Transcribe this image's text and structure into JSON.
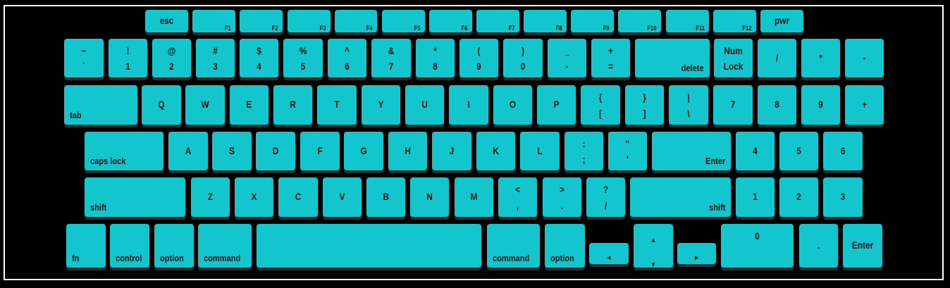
{
  "keyboard": {
    "key_color": "#13c5cd",
    "keys": [
      {
        "id": "esc",
        "label": "esc"
      },
      {
        "id": "f1",
        "label": "F1"
      },
      {
        "id": "f2",
        "label": "F2"
      },
      {
        "id": "f3",
        "label": "F3"
      },
      {
        "id": "f4",
        "label": "F4"
      },
      {
        "id": "f5",
        "label": "F5"
      },
      {
        "id": "f6",
        "label": "F6"
      },
      {
        "id": "f7",
        "label": "F7"
      },
      {
        "id": "f8",
        "label": "F8"
      },
      {
        "id": "f9",
        "label": "F9"
      },
      {
        "id": "f10",
        "label": "F10"
      },
      {
        "id": "f11",
        "label": "F11"
      },
      {
        "id": "f12",
        "label": "F12"
      },
      {
        "id": "pwr",
        "label": "pwr"
      },
      {
        "id": "backtick",
        "top": "~",
        "bottom": "`"
      },
      {
        "id": "1",
        "top": "!",
        "bottom": "1"
      },
      {
        "id": "2",
        "top": "@",
        "bottom": "2"
      },
      {
        "id": "3",
        "top": "#",
        "bottom": "3"
      },
      {
        "id": "4",
        "top": "$",
        "bottom": "4"
      },
      {
        "id": "5",
        "top": "%",
        "bottom": "5"
      },
      {
        "id": "6",
        "top": "^",
        "bottom": "6"
      },
      {
        "id": "7",
        "top": "&",
        "bottom": "7"
      },
      {
        "id": "8",
        "top": "*",
        "bottom": "8"
      },
      {
        "id": "9",
        "top": "(",
        "bottom": "9"
      },
      {
        "id": "0",
        "top": ")",
        "bottom": "0"
      },
      {
        "id": "minus",
        "top": "_",
        "bottom": "-"
      },
      {
        "id": "equals",
        "top": "+",
        "bottom": "="
      },
      {
        "id": "delete",
        "label": "delete"
      },
      {
        "id": "numlock",
        "top": "Num",
        "bottom": "Lock"
      },
      {
        "id": "num-slash",
        "label": "/"
      },
      {
        "id": "num-star",
        "label": "*"
      },
      {
        "id": "num-minus",
        "label": "-"
      },
      {
        "id": "tab",
        "label": "tab"
      },
      {
        "id": "q",
        "label": "Q"
      },
      {
        "id": "w",
        "label": "W"
      },
      {
        "id": "e",
        "label": "E"
      },
      {
        "id": "r",
        "label": "R"
      },
      {
        "id": "t",
        "label": "T"
      },
      {
        "id": "y",
        "label": "Y"
      },
      {
        "id": "u",
        "label": "U"
      },
      {
        "id": "i",
        "label": "I"
      },
      {
        "id": "o",
        "label": "O"
      },
      {
        "id": "p",
        "label": "P"
      },
      {
        "id": "lbracket",
        "top": "{",
        "bottom": "["
      },
      {
        "id": "rbracket",
        "top": "}",
        "bottom": "]"
      },
      {
        "id": "backslash",
        "top": "|",
        "bottom": "\\"
      },
      {
        "id": "num7",
        "label": "7"
      },
      {
        "id": "num8",
        "label": "8"
      },
      {
        "id": "num9",
        "label": "9"
      },
      {
        "id": "num-plus",
        "label": "+"
      },
      {
        "id": "capslock",
        "label": "caps lock"
      },
      {
        "id": "a",
        "label": "A"
      },
      {
        "id": "s",
        "label": "S"
      },
      {
        "id": "d",
        "label": "D"
      },
      {
        "id": "f",
        "label": "F"
      },
      {
        "id": "g",
        "label": "G"
      },
      {
        "id": "h",
        "label": "H"
      },
      {
        "id": "j",
        "label": "J"
      },
      {
        "id": "k",
        "label": "K"
      },
      {
        "id": "l",
        "label": "L"
      },
      {
        "id": "semicolon",
        "top": ":",
        "bottom": ";"
      },
      {
        "id": "quote",
        "top": "\"",
        "bottom": "'"
      },
      {
        "id": "enter",
        "label": "Enter"
      },
      {
        "id": "num4",
        "label": "4"
      },
      {
        "id": "num5",
        "label": "5"
      },
      {
        "id": "num6",
        "label": "6"
      },
      {
        "id": "lshift",
        "label": "shift"
      },
      {
        "id": "z",
        "label": "Z"
      },
      {
        "id": "x",
        "label": "X"
      },
      {
        "id": "c",
        "label": "C"
      },
      {
        "id": "v",
        "label": "V"
      },
      {
        "id": "b",
        "label": "B"
      },
      {
        "id": "n",
        "label": "N"
      },
      {
        "id": "m",
        "label": "M"
      },
      {
        "id": "comma",
        "top": "<",
        "bottom": ","
      },
      {
        "id": "period",
        "top": ">",
        "bottom": "."
      },
      {
        "id": "slash",
        "top": "?",
        "bottom": "/"
      },
      {
        "id": "rshift",
        "label": "shift"
      },
      {
        "id": "num1",
        "label": "1"
      },
      {
        "id": "num2",
        "label": "2"
      },
      {
        "id": "num3",
        "label": "3"
      },
      {
        "id": "fn",
        "label": "fn"
      },
      {
        "id": "control",
        "label": "control"
      },
      {
        "id": "loption",
        "label": "option"
      },
      {
        "id": "lcommand",
        "label": "command"
      },
      {
        "id": "space",
        "label": ""
      },
      {
        "id": "rcommand",
        "label": "command"
      },
      {
        "id": "roption",
        "label": "option"
      },
      {
        "id": "left",
        "label": "◄"
      },
      {
        "id": "updown",
        "top": "▲",
        "bottom": "▼"
      },
      {
        "id": "right",
        "label": "►"
      },
      {
        "id": "num0",
        "top": "0"
      },
      {
        "id": "num-dot",
        "label": "."
      },
      {
        "id": "num-enter",
        "label": "Enter"
      }
    ]
  }
}
